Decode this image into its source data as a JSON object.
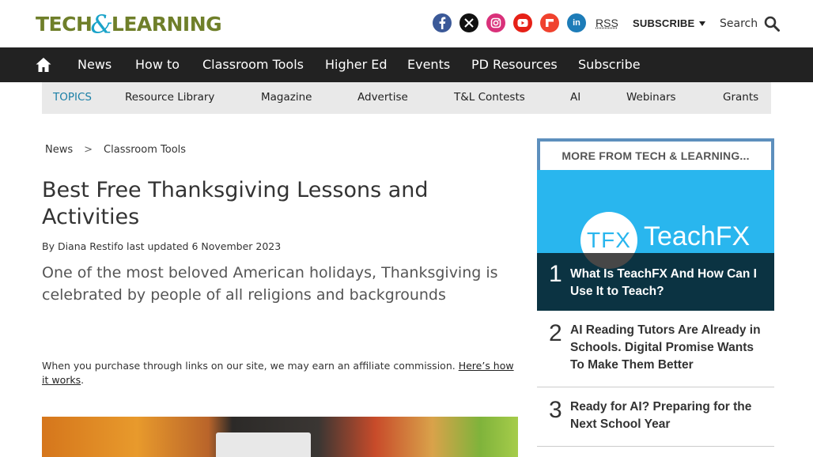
{
  "header": {
    "logo": {
      "part1": "TECH",
      "amp": "&",
      "part2": "LEARNING"
    },
    "socials": [
      "facebook-icon",
      "x-icon",
      "instagram-icon",
      "youtube-icon",
      "flipboard-icon",
      "linkedin-icon"
    ],
    "linkedin_glyph": "in",
    "rss_label": "RSS",
    "subscribe_label": "SUBSCRIBE",
    "search_label": "Search"
  },
  "main_nav": {
    "home_icon": "home-icon",
    "items": [
      "News",
      "How to",
      "Classroom Tools",
      "Higher Ed",
      "Events",
      "PD Resources",
      "Subscribe"
    ]
  },
  "sub_nav": {
    "topics_label": "TOPICS",
    "items": [
      "Resource Library",
      "Magazine",
      "Advertise",
      "T&L Contests",
      "AI",
      "Webinars",
      "Grants"
    ]
  },
  "article": {
    "breadcrumb": [
      "News",
      "Classroom Tools"
    ],
    "breadcrumb_sep": ">",
    "title": "Best Free Thanksgiving Lessons and Activities",
    "byline": "By Diana Restifo last updated 6 November 2023",
    "standfirst": "One of the most beloved American holidays, Thanksgiving is celebrated by people of all religions and backgrounds",
    "affiliate_text": "When you purchase through links on our site, we may earn an affiliate commission.",
    "affiliate_link": "Here’s how it works",
    "affiliate_end": "."
  },
  "sidebar": {
    "heading": "MORE FROM TECH & LEARNING...",
    "feature": {
      "logo_circle": "TFX",
      "logo_word": "TeachFX",
      "rank": "1",
      "title": "What Is TeachFX And How Can I Use It to Teach?"
    },
    "items": [
      {
        "rank": "2",
        "title": "AI Reading Tutors Are Already in Schools. Digital Promise Wants To Make Them Better"
      },
      {
        "rank": "3",
        "title": "Ready for AI? Preparing for the Next School Year"
      }
    ]
  },
  "colors": {
    "nav_bg": "#222222",
    "subnav_bg": "#e9e9e9",
    "topics_accent": "#1a7fa6",
    "logo_green": "#6f7f2a",
    "logo_blue": "#1aa3c9",
    "sidebar_border": "#5d8fbd",
    "feature_bg": "#29b6ee"
  }
}
